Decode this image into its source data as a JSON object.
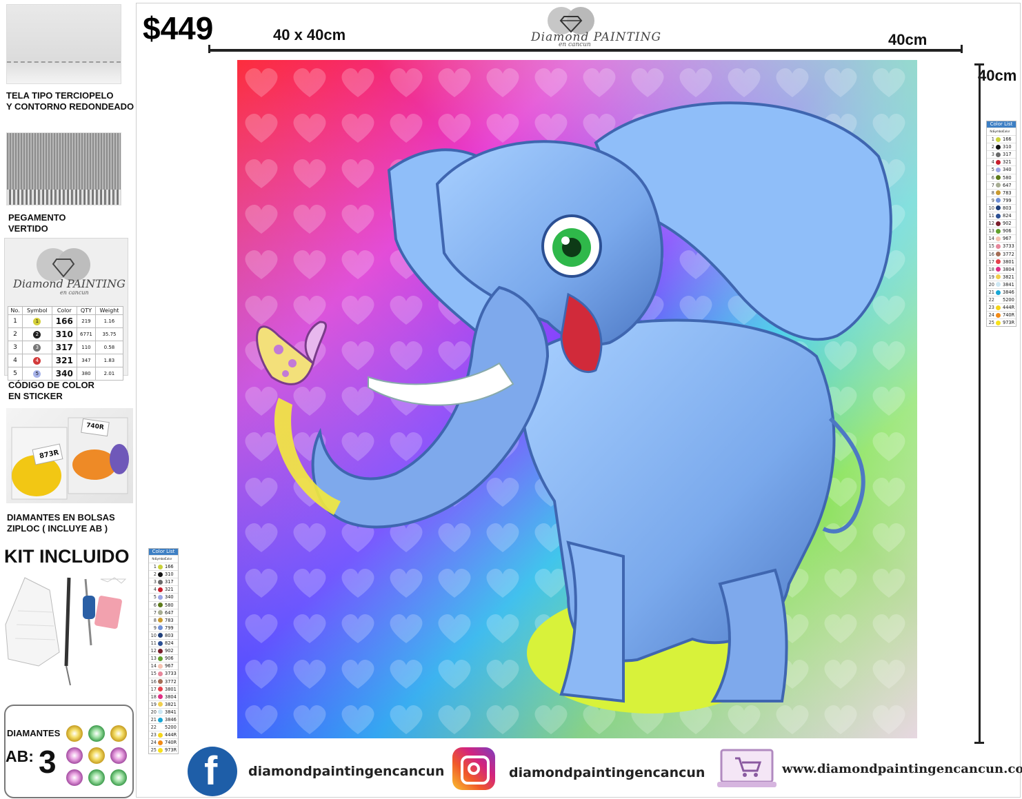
{
  "left_panel": {
    "fabric_caption_1": "TELA TIPO TERCIOPELO",
    "fabric_caption_2": "Y CONTORNO REDONDEADO",
    "glue_caption_1": "PEGAMENTO",
    "glue_caption_2": "VERTIDO",
    "sticker_caption_1": "CÓDIGO DE COLOR",
    "sticker_caption_2": "EN STICKER",
    "bags_caption_1": "DIAMANTES EN BOLSAS",
    "bags_caption_2": "ZIPLOC ( INCLUYE AB )",
    "kit_title": "KIT INCLUIDO",
    "ab_label": "DIAMANTES",
    "ab_prefix": "AB:",
    "ab_count": "3"
  },
  "sticker_sample": {
    "brand": "Diamond PAINTING",
    "brand_sub": "en cancun",
    "headers": [
      "No.",
      "Symbol",
      "Color",
      "QTY",
      "Weight"
    ],
    "rows": [
      [
        "1",
        "1",
        "166",
        "219",
        "1.16"
      ],
      [
        "2",
        "2",
        "310",
        "6771",
        "35.75"
      ],
      [
        "3",
        "3",
        "317",
        "110",
        "0.58"
      ],
      [
        "4",
        "4",
        "321",
        "347",
        "1.83"
      ],
      [
        "5",
        "5",
        "340",
        "380",
        "2.01"
      ]
    ],
    "bag_labels": [
      "740R",
      "873R"
    ]
  },
  "header": {
    "price": "$449",
    "size_label": "40 x 40cm",
    "width_label": "40cm",
    "height_label": "40cm",
    "logo_text": "Diamond PAINTING",
    "logo_sub": "en cancun"
  },
  "color_list": {
    "title": "Color List",
    "headers": [
      "No.",
      "Symbol",
      "Color"
    ],
    "rows": [
      {
        "n": "1",
        "s": "1",
        "c": "166",
        "hex": "#c9d13a"
      },
      {
        "n": "2",
        "s": "2",
        "c": "310",
        "hex": "#111111"
      },
      {
        "n": "3",
        "s": "3",
        "c": "317",
        "hex": "#6a6a6a"
      },
      {
        "n": "4",
        "s": "4",
        "c": "321",
        "hex": "#c81e2c"
      },
      {
        "n": "5",
        "s": "5",
        "c": "340",
        "hex": "#9aa4e4"
      },
      {
        "n": "6",
        "s": "6",
        "c": "580",
        "hex": "#5c7a1a"
      },
      {
        "n": "7",
        "s": "7",
        "c": "647",
        "hex": "#a7ad93"
      },
      {
        "n": "8",
        "s": "8",
        "c": "783",
        "hex": "#c99a2e"
      },
      {
        "n": "9",
        "s": "A",
        "c": "799",
        "hex": "#6f8fd6"
      },
      {
        "n": "10",
        "s": "C",
        "c": "803",
        "hex": "#1f3f7a"
      },
      {
        "n": "11",
        "s": "D",
        "c": "824",
        "hex": "#2b4f93"
      },
      {
        "n": "12",
        "s": "E",
        "c": "902",
        "hex": "#7a1e2b"
      },
      {
        "n": "13",
        "s": "G",
        "c": "906",
        "hex": "#62a12d"
      },
      {
        "n": "14",
        "s": "H",
        "c": "967",
        "hex": "#f6c2b1"
      },
      {
        "n": "15",
        "s": "J",
        "c": "3733",
        "hex": "#e7879b"
      },
      {
        "n": "16",
        "s": "K",
        "c": "3772",
        "hex": "#a46d55"
      },
      {
        "n": "17",
        "s": "N",
        "c": "3801",
        "hex": "#e5424c"
      },
      {
        "n": "18",
        "s": "Q",
        "c": "3804",
        "hex": "#df2f85"
      },
      {
        "n": "19",
        "s": "R",
        "c": "3821",
        "hex": "#f1cf4d"
      },
      {
        "n": "20",
        "s": "S",
        "c": "3841",
        "hex": "#cde7f3"
      },
      {
        "n": "21",
        "s": "T",
        "c": "3846",
        "hex": "#18a6d4"
      },
      {
        "n": "22",
        "s": "U",
        "c": "5200",
        "hex": "#ffffff"
      },
      {
        "n": "23",
        "s": "V",
        "c": "444R",
        "hex": "#f5d51a"
      },
      {
        "n": "24",
        "s": "W",
        "c": "740R",
        "hex": "#f28a16"
      },
      {
        "n": "25",
        "s": "X",
        "c": "973R",
        "hex": "#f7e11c"
      }
    ]
  },
  "footer": {
    "facebook_handle": "diamondpaintingencancun",
    "instagram_handle": "diamondpaintingencancun",
    "website": "www.diamondpaintingencancun.com",
    "facebook_glyph": "f"
  },
  "colors": {
    "facebook_blue": "#1e5ea8",
    "elephant_blue": "#7fb0ee",
    "rule_black": "#222222"
  }
}
